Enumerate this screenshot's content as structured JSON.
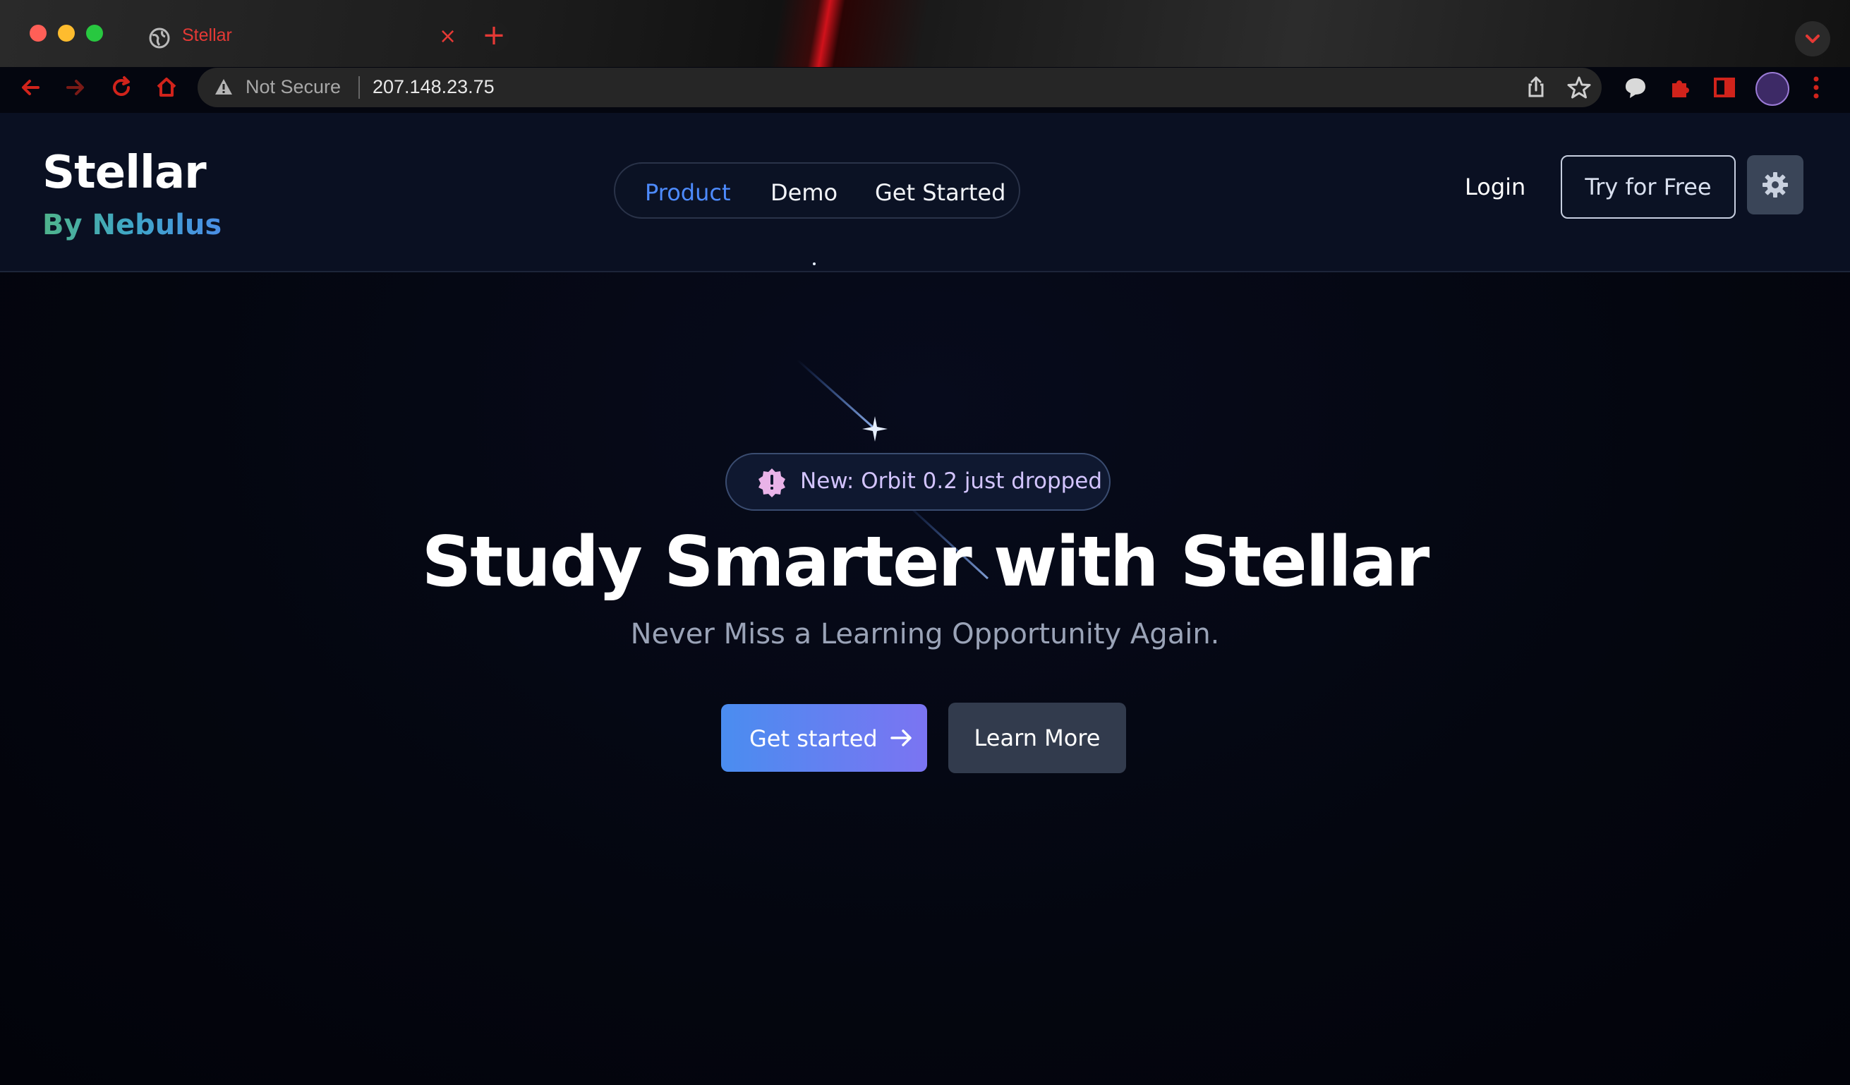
{
  "browser": {
    "tab_title": "Stellar",
    "tab_close": "×",
    "new_tab": "+",
    "security_label": "Not Secure",
    "url": "207.148.23.75"
  },
  "header": {
    "brand_name": "Stellar",
    "brand_byline": "By Nebulus",
    "nav": {
      "product": "Product",
      "demo": "Demo",
      "get_started": "Get Started"
    },
    "login": "Login",
    "try_free": "Try for Free"
  },
  "hero": {
    "badge_text": "New: Orbit 0.2 just dropped",
    "headline": "Study Smarter with Stellar",
    "subheadline": "Never Miss a Learning Opportunity Again.",
    "primary_cta": "Get started",
    "secondary_cta": "Learn More"
  },
  "colors": {
    "accent_blue": "#4d8bff",
    "cta_gradient_start": "#4a8df0",
    "cta_gradient_end": "#7b74f2",
    "page_bg": "#04060f",
    "browser_accent": "#e53935"
  }
}
